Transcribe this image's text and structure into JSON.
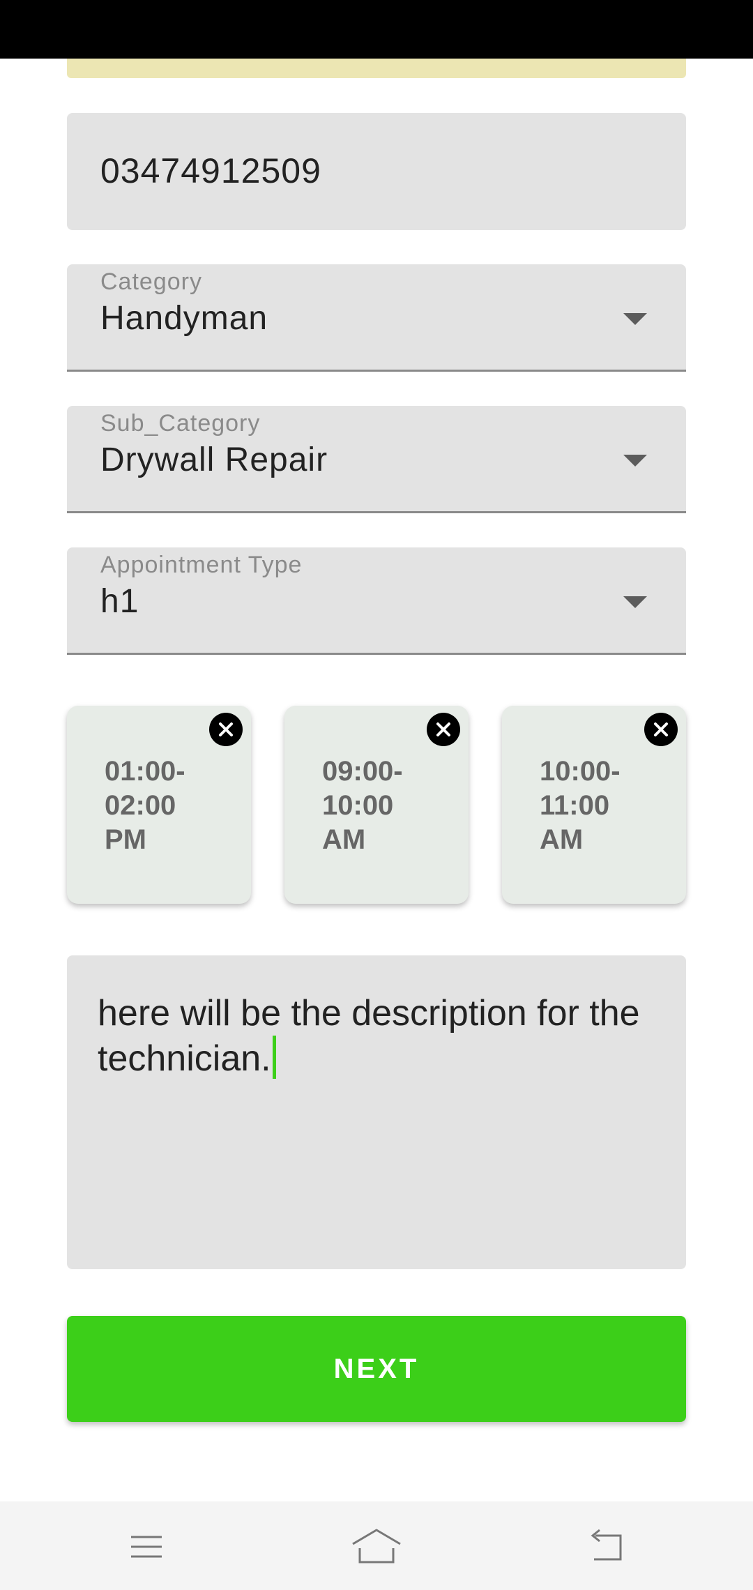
{
  "form": {
    "phone_value": "03474912509",
    "category": {
      "label": "Category",
      "value": "Handyman"
    },
    "sub_category": {
      "label": "Sub_Category",
      "value": "Drywall Repair"
    },
    "appointment_type": {
      "label": "Appointment Type",
      "value": "h1"
    },
    "time_slots": [
      {
        "line1": "01:00-",
        "line2": "02:00",
        "line3": "PM"
      },
      {
        "line1": "09:00-",
        "line2": "10:00",
        "line3": "AM"
      },
      {
        "line1": "10:00-",
        "line2": "11:00",
        "line3": "AM"
      }
    ],
    "description": "here will be the description for the technician.",
    "next_label": "NEXT"
  },
  "colors": {
    "accent": "#3ccf19",
    "field_bg": "#e3e3e3",
    "slot_bg": "#e7ece7",
    "notice_strip": "#ece6b3"
  },
  "icons": {
    "dropdown": "chevron-down-icon",
    "slot_remove": "close-icon",
    "nav": [
      "menu-icon",
      "home-icon",
      "back-icon"
    ]
  }
}
